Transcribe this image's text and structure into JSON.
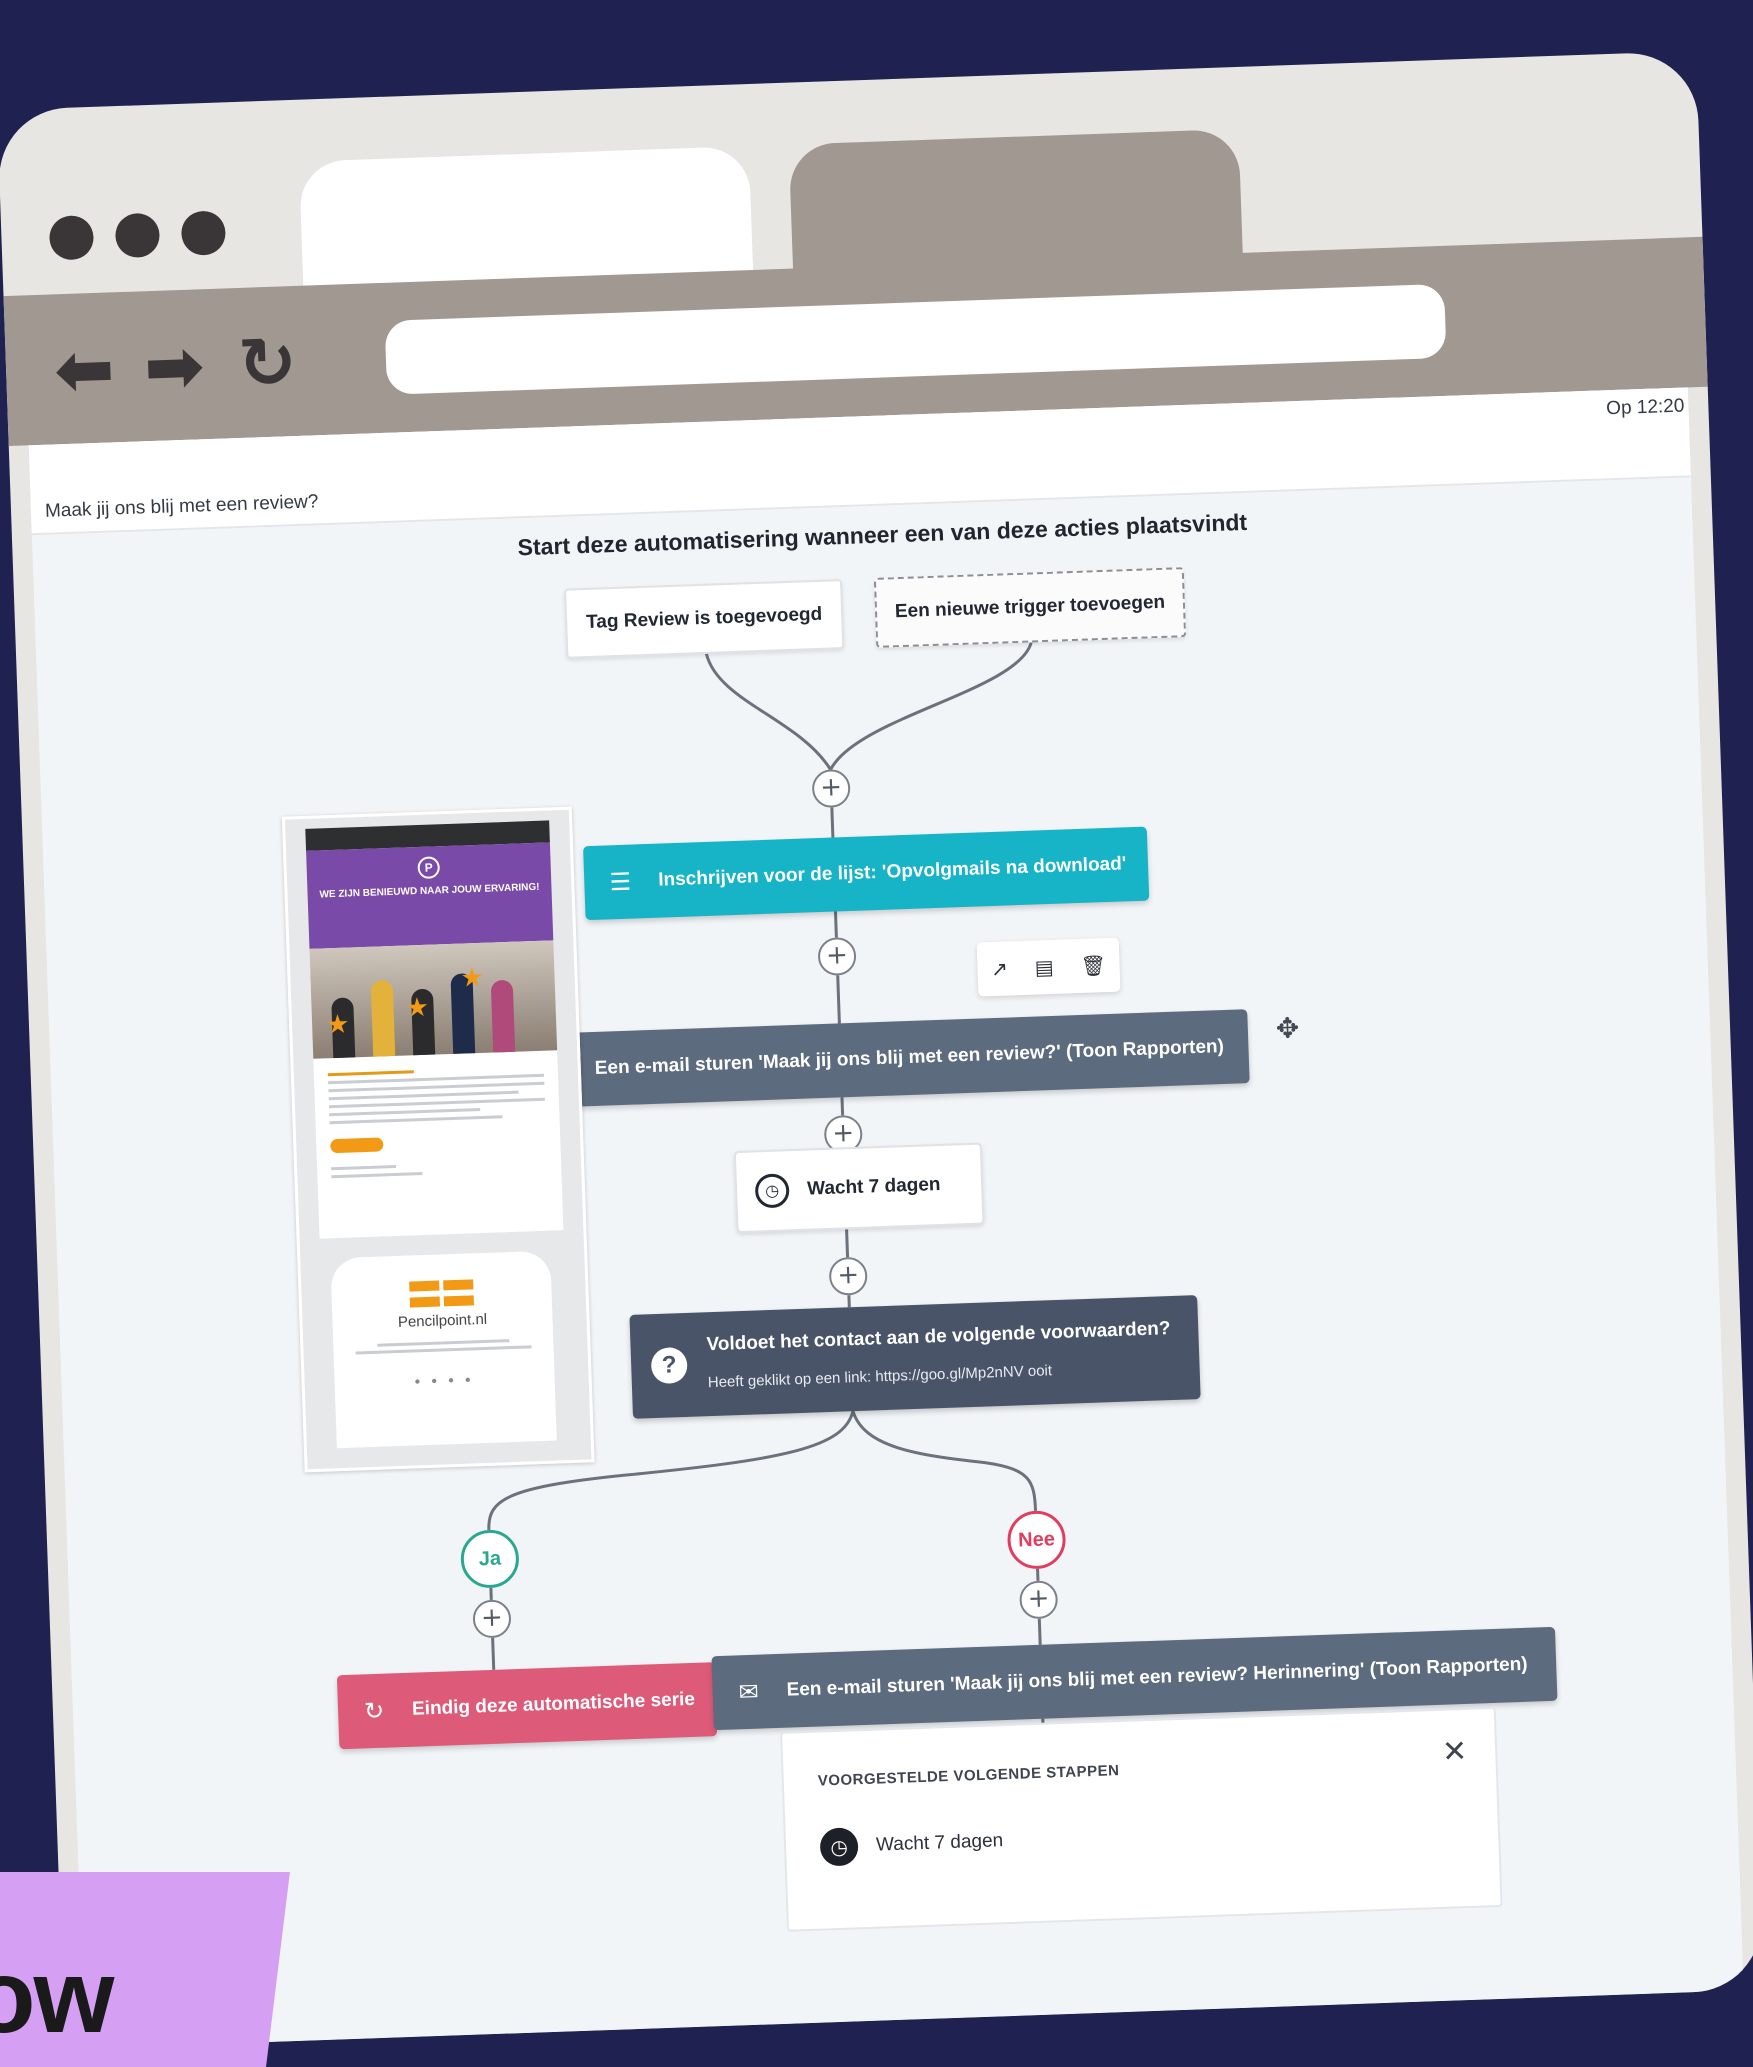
{
  "browser": {
    "nav_back": "⬅",
    "nav_forward": "➡",
    "nav_reload": "↻",
    "url": ""
  },
  "app": {
    "campaign_name": "Maak jij ons blij met een review?",
    "saved_status": "Op 12:20"
  },
  "flow": {
    "heading": "Start deze automatisering wanneer een van deze acties plaatsvindt",
    "triggers": [
      "Tag Review is toegevoegd",
      "Een nieuwe trigger toevoegen"
    ],
    "plus": "+",
    "steps": {
      "subscribe": "Inschrijven voor de lijst: 'Opvolgmails na download'",
      "email1": "Een e-mail sturen 'Maak jij ons blij met een review?' (Toon Rapporten)",
      "wait": "Wacht 7 dagen",
      "condition_title": "Voldoet het contact aan de volgende voorwaarden?",
      "condition_detail": "Heeft geklikt op een link: https://goo.gl/Mp2nNV ooit",
      "branch_yes": "Ja",
      "branch_no": "Nee",
      "end": "Eindig deze automatische serie",
      "email2": "Een e-mail sturen 'Maak jij ons blij met een review? Herinnering' (Toon Rapporten)"
    },
    "icons": {
      "list": "☰",
      "email": "✉",
      "clock": "◷",
      "question": "?",
      "end": "↻",
      "move": "✥",
      "open": "↗",
      "note": "▤",
      "trash": "🗑"
    }
  },
  "email_preview": {
    "logo": "P",
    "hero": "WE ZIJN BENIEUWD NAAR JOUW ERVARING!",
    "brand": "Pencilpoint.nl"
  },
  "suggestions": {
    "title": "VOORGESTELDE VOLGENDE STAPPEN",
    "close": "✕",
    "item": "Wacht 7 dagen"
  },
  "promo": {
    "text": "ow"
  },
  "colors": {
    "page_background": "#1f2150",
    "subscribe_step": "#17b3c6",
    "email_step": "#5c6b7e",
    "condition_step": "#4a5468",
    "end_step": "#dd5b78",
    "branch_yes": "#2aa88f",
    "branch_no": "#e23d5e",
    "promo": "#d5a0f4"
  }
}
